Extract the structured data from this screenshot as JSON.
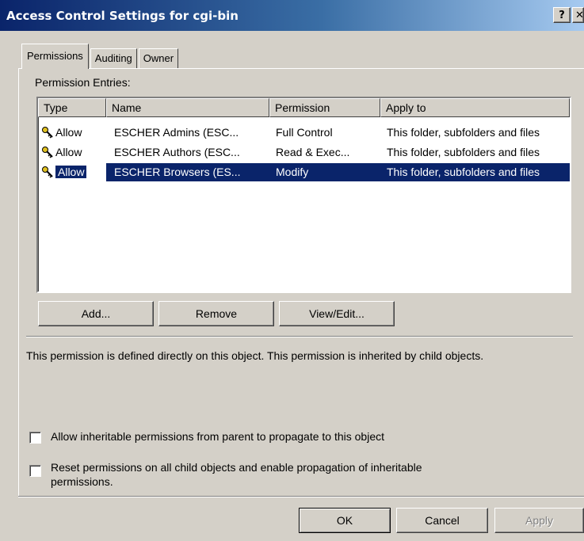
{
  "window": {
    "title": "Access Control Settings for cgi-bin",
    "help_label": "?",
    "close_label": "✕"
  },
  "tabs": [
    {
      "label": "Permissions",
      "active": true
    },
    {
      "label": "Auditing",
      "active": false
    },
    {
      "label": "Owner",
      "active": false
    }
  ],
  "permission_entries": {
    "label": "Permission Entries:",
    "columns": [
      "Type",
      "Name",
      "Permission",
      "Apply to"
    ],
    "rows": [
      {
        "type": "Allow",
        "name": "ESCHER Admins (ESC...",
        "permission": "Full Control",
        "apply_to": "This folder, subfolders and files",
        "icon": "key-icon"
      },
      {
        "type": "Allow",
        "name": "ESCHER Authors (ESC...",
        "permission": "Read & Exec...",
        "apply_to": "This folder, subfolders and files",
        "icon": "key-icon"
      },
      {
        "type": "Allow",
        "name": "ESCHER Browsers (ES...",
        "permission": "Modify",
        "apply_to": "This folder, subfolders and files",
        "icon": "key-icon",
        "selected": true
      }
    ]
  },
  "buttons": {
    "add": "Add...",
    "remove": "Remove",
    "view_edit": "View/Edit..."
  },
  "description": "This permission is defined directly on this object. This permission is inherited by child objects.",
  "checkboxes": {
    "inherit": {
      "label": "Allow inheritable permissions from parent to propagate to this object",
      "checked": false
    },
    "reset": {
      "line1": "Reset permissions on all child objects and enable propagation of inheritable",
      "line2": "permissions.",
      "checked": false
    }
  },
  "dialog_buttons": {
    "ok": "OK",
    "cancel": "Cancel",
    "apply": "Apply"
  },
  "colors": {
    "selection": "#0a246a",
    "face": "#d4d0c8"
  }
}
